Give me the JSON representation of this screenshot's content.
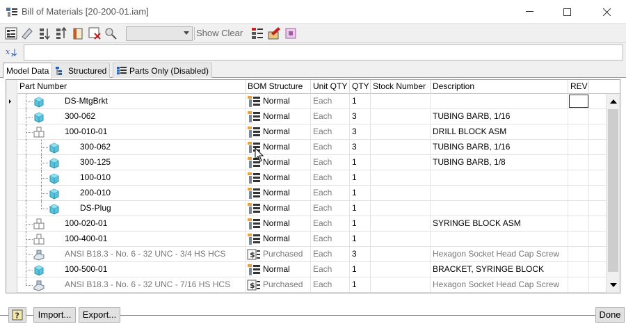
{
  "window": {
    "title": "Bill of Materials [20-200-01.iam]"
  },
  "toolbar": {
    "icons": [
      "bom-props-icon",
      "edit-icon",
      "sort-asc-icon",
      "sort-desc-icon",
      "open-file-icon",
      "delete-icon",
      "find-icon",
      "filter-icon",
      "edit-item-icon",
      "renumber-icon"
    ],
    "show_clear_label": "Show Clear",
    "combo_value": ""
  },
  "filter": {
    "icon": "formula-icon",
    "value": ""
  },
  "tabs": [
    {
      "label": "Model Data",
      "active": true
    },
    {
      "label": "Structured",
      "active": false
    },
    {
      "label": "Parts Only (Disabled)",
      "active": false
    }
  ],
  "table": {
    "columns": [
      "Part Number",
      "BOM Structure",
      "Unit QTY",
      "QTY",
      "Stock Number",
      "Description",
      "REV"
    ],
    "rows": [
      {
        "part": "DS-MtgBrkt",
        "level": 0,
        "icon": "part-icon",
        "structure": "Normal",
        "unit": "Each",
        "qty": "1",
        "stock": "",
        "desc": "",
        "rev": "",
        "gray": false
      },
      {
        "part": "300-062",
        "level": 0,
        "icon": "part-icon",
        "structure": "Normal",
        "unit": "Each",
        "qty": "3",
        "stock": "",
        "desc": "TUBING BARB, 1/16",
        "rev": "",
        "gray": false
      },
      {
        "part": "100-010-01",
        "level": 0,
        "icon": "assembly-icon",
        "structure": "Normal",
        "unit": "Each",
        "qty": "3",
        "stock": "",
        "desc": "DRILL BLOCK ASM",
        "rev": "",
        "gray": false
      },
      {
        "part": "300-062",
        "level": 1,
        "icon": "part-icon",
        "structure": "Normal",
        "unit": "Each",
        "qty": "3",
        "stock": "",
        "desc": "TUBING BARB, 1/16",
        "rev": "",
        "gray": false
      },
      {
        "part": "300-125",
        "level": 1,
        "icon": "part-icon",
        "structure": "Normal",
        "unit": "Each",
        "qty": "1",
        "stock": "",
        "desc": "TUBING BARB, 1/8",
        "rev": "",
        "gray": false
      },
      {
        "part": "100-010",
        "level": 1,
        "icon": "part-icon",
        "structure": "Normal",
        "unit": "Each",
        "qty": "1",
        "stock": "",
        "desc": "",
        "rev": "",
        "gray": false
      },
      {
        "part": "200-010",
        "level": 1,
        "icon": "part-icon",
        "structure": "Normal",
        "unit": "Each",
        "qty": "1",
        "stock": "",
        "desc": "",
        "rev": "",
        "gray": false
      },
      {
        "part": "DS-Plug",
        "level": 1,
        "icon": "part-icon",
        "structure": "Normal",
        "unit": "Each",
        "qty": "1",
        "stock": "",
        "desc": "",
        "rev": "",
        "gray": false
      },
      {
        "part": "100-020-01",
        "level": 0,
        "icon": "assembly-icon",
        "structure": "Normal",
        "unit": "Each",
        "qty": "1",
        "stock": "",
        "desc": "SYRINGE BLOCK ASM",
        "rev": "",
        "gray": false
      },
      {
        "part": "100-400-01",
        "level": 0,
        "icon": "assembly-icon",
        "structure": "Normal",
        "unit": "Each",
        "qty": "1",
        "stock": "",
        "desc": "",
        "rev": "",
        "gray": false
      },
      {
        "part": "ANSI B18.3 - No. 6 - 32 UNC - 3/4 HS HCS",
        "level": 0,
        "icon": "library-part-icon",
        "structure": "Purchased",
        "unit": "Each",
        "qty": "3",
        "stock": "",
        "desc": "Hexagon Socket Head Cap Screw",
        "rev": "",
        "gray": true
      },
      {
        "part": "100-500-01",
        "level": 0,
        "icon": "part-icon",
        "structure": "Normal",
        "unit": "Each",
        "qty": "1",
        "stock": "",
        "desc": "BRACKET, SYRINGE BLOCK",
        "rev": "",
        "gray": false
      },
      {
        "part": "ANSI B18.3 - No. 6 - 32 UNC - 7/16 HS HCS",
        "level": 0,
        "icon": "library-part-icon",
        "structure": "Purchased",
        "unit": "Each",
        "qty": "1",
        "stock": "",
        "desc": "Hexagon Socket Head Cap Screw",
        "rev": "",
        "gray": true
      }
    ]
  },
  "footer": {
    "help_icon": "help-icon",
    "import_label": "Import...",
    "export_label": "Export...",
    "done_label": "Done"
  }
}
